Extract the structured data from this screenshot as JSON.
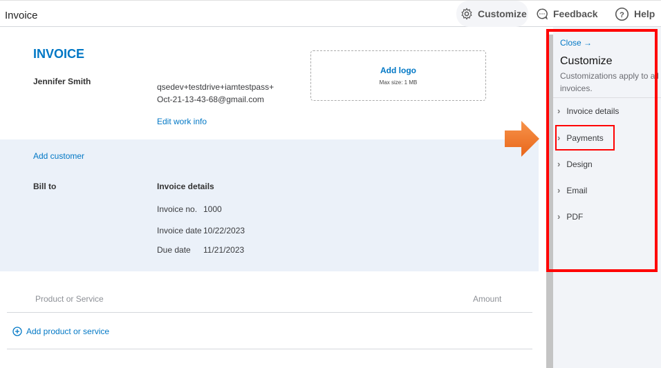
{
  "header": {
    "title": "Invoice",
    "customize": "Customize",
    "feedback": "Feedback",
    "help": "Help"
  },
  "invoice": {
    "heading": "INVOICE",
    "company_name": "Jennifer Smith",
    "email_line1": "qsedev+testdrive+iamtestpass+",
    "email_line2": "Oct-21-13-43-68@gmail.com",
    "edit_work_info": "Edit work info",
    "add_logo": "Add logo",
    "logo_max": "Max size: 1 MB",
    "add_customer": "Add customer",
    "bill_to": "Bill to",
    "details_heading": "Invoice details",
    "invoice_no_label": "Invoice no.",
    "invoice_no": "1000",
    "invoice_date_label": "Invoice date",
    "invoice_date": "10/22/2023",
    "due_date_label": "Due date",
    "due_date": "11/21/2023"
  },
  "table": {
    "col_product": "Product or Service",
    "col_amount": "Amount",
    "add_product": "Add product or service"
  },
  "panel": {
    "close": "Close →",
    "title": "Customize",
    "subtitle": "Customizations apply to all invoices.",
    "items": [
      {
        "label": "Invoice details"
      },
      {
        "label": "Payments"
      },
      {
        "label": "Design"
      },
      {
        "label": "Email"
      },
      {
        "label": "PDF"
      }
    ]
  },
  "colors": {
    "accent": "#0077c5",
    "highlight": "#ff0000",
    "arrow": "#f07820"
  }
}
